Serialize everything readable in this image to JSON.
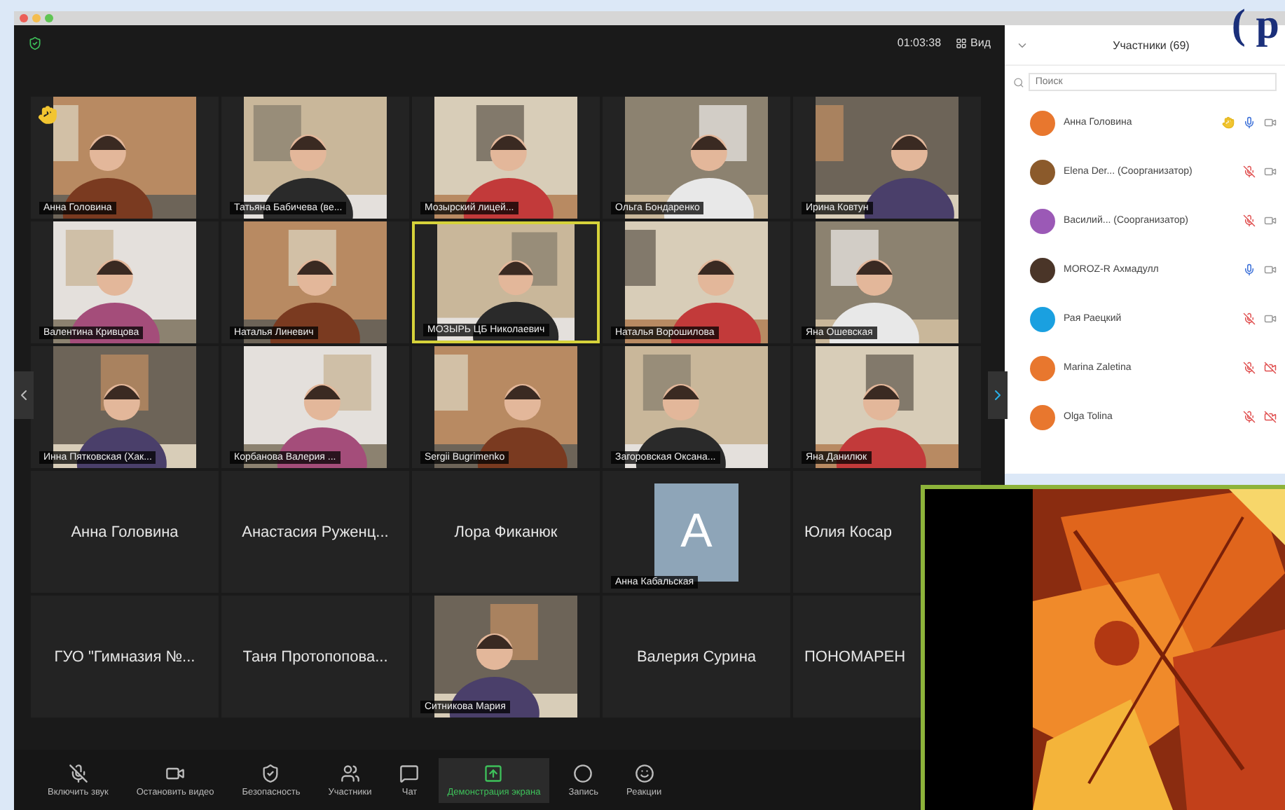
{
  "slide_heading_fragment": "( р",
  "top_bar": {
    "timer": "01:03:38",
    "view_button": "Вид"
  },
  "tiles": [
    {
      "kind": "video",
      "label": "Анна Головина",
      "hand": true,
      "speaking": false
    },
    {
      "kind": "video",
      "label": "Татьяна Бабичева (ве...",
      "hand": false,
      "speaking": false
    },
    {
      "kind": "video",
      "label": "Мозырский лицей...",
      "hand": false,
      "speaking": false
    },
    {
      "kind": "video",
      "label": "Ольга Бондаренко",
      "hand": false,
      "speaking": false
    },
    {
      "kind": "video",
      "label": "Ирина Ковтун",
      "hand": false,
      "speaking": false
    },
    {
      "kind": "video",
      "label": "Валентина Кривцова",
      "hand": false,
      "speaking": false
    },
    {
      "kind": "video",
      "label": "Наталья Линевич",
      "hand": false,
      "speaking": false
    },
    {
      "kind": "video",
      "label": "МОЗЫРЬ ЦБ Николаевич",
      "hand": false,
      "speaking": true
    },
    {
      "kind": "video",
      "label": "Наталья Ворошилова",
      "hand": false,
      "speaking": false
    },
    {
      "kind": "video",
      "label": "Яна Ошевская",
      "hand": false,
      "speaking": false
    },
    {
      "kind": "video",
      "label": "Инна Пятковская (Хак...",
      "hand": false,
      "speaking": false
    },
    {
      "kind": "video",
      "label": "Корбанова Валерия ...",
      "hand": false,
      "speaking": false
    },
    {
      "kind": "video",
      "label": "Sergii Bugrimenko",
      "hand": false,
      "speaking": false
    },
    {
      "kind": "video",
      "label": "Загоровская Оксана...",
      "hand": false,
      "speaking": false
    },
    {
      "kind": "video",
      "label": "Яна Данилюк",
      "hand": false,
      "speaking": false
    },
    {
      "kind": "name",
      "name": "Анна Головина",
      "partly_covered": false
    },
    {
      "kind": "name",
      "name": "Анастасия Руженц...",
      "partly_covered": false
    },
    {
      "kind": "name",
      "name": "Лора Фиканюк",
      "partly_covered": false
    },
    {
      "kind": "avatar",
      "letter": "A",
      "label": "Анна Кабальская"
    },
    {
      "kind": "name",
      "name": "Юлия Косар",
      "partly_covered": true
    },
    {
      "kind": "name",
      "name": "ГУО \"Гимназия №...",
      "partly_covered": false
    },
    {
      "kind": "name",
      "name": "Таня Протопопова...",
      "partly_covered": false
    },
    {
      "kind": "video",
      "label": "Ситникова Мария",
      "hand": false,
      "speaking": false
    },
    {
      "kind": "name",
      "name": "Валерия Сурина",
      "partly_covered": false
    },
    {
      "kind": "name",
      "name": "ПОНОМАРЕН",
      "partly_covered": true
    }
  ],
  "participants_panel": {
    "title": "Участники (69)",
    "search": {
      "placeholder": "Поиск"
    },
    "participants": [
      {
        "name": "Анна Головина",
        "color": "#e8772e",
        "hand": true,
        "mic_muted": false,
        "video_off": false
      },
      {
        "name": "Elena Der...",
        "role": "(Соорганизатор)",
        "color": "#8b5a2b",
        "hand": false,
        "mic_muted": true,
        "video_off": false
      },
      {
        "name": "Василий...",
        "role": "(Соорганизатор)",
        "color": "#9b59b6",
        "hand": false,
        "mic_muted": true,
        "video_off": false
      },
      {
        "name": "MOROZ-R Ахмадулл",
        "color": "#4a3528",
        "hand": false,
        "mic_muted": false,
        "video_off": false
      },
      {
        "name": "Рая Раецкий",
        "color": "#1aa0e0",
        "hand": false,
        "mic_muted": true,
        "video_off": false
      },
      {
        "name": "Marina Zaletina",
        "color": "#e8772e",
        "hand": false,
        "mic_muted": true,
        "video_off": true
      },
      {
        "name": "Olga Tolina",
        "color": "#e8772e",
        "hand": false,
        "mic_muted": true,
        "video_off": true
      }
    ]
  },
  "toolbar": [
    {
      "kind": "mic",
      "label": "Включить звук",
      "muted": true
    },
    {
      "kind": "camera",
      "label": "Остановить видео"
    },
    {
      "kind": "security",
      "label": "Безопасность"
    },
    {
      "kind": "participants",
      "label": "Участники"
    },
    {
      "kind": "chat",
      "label": "Чат"
    },
    {
      "kind": "share",
      "label": "Демонстрация экрана"
    },
    {
      "kind": "record",
      "label": "Запись"
    },
    {
      "kind": "reactions",
      "label": "Реакции"
    }
  ]
}
